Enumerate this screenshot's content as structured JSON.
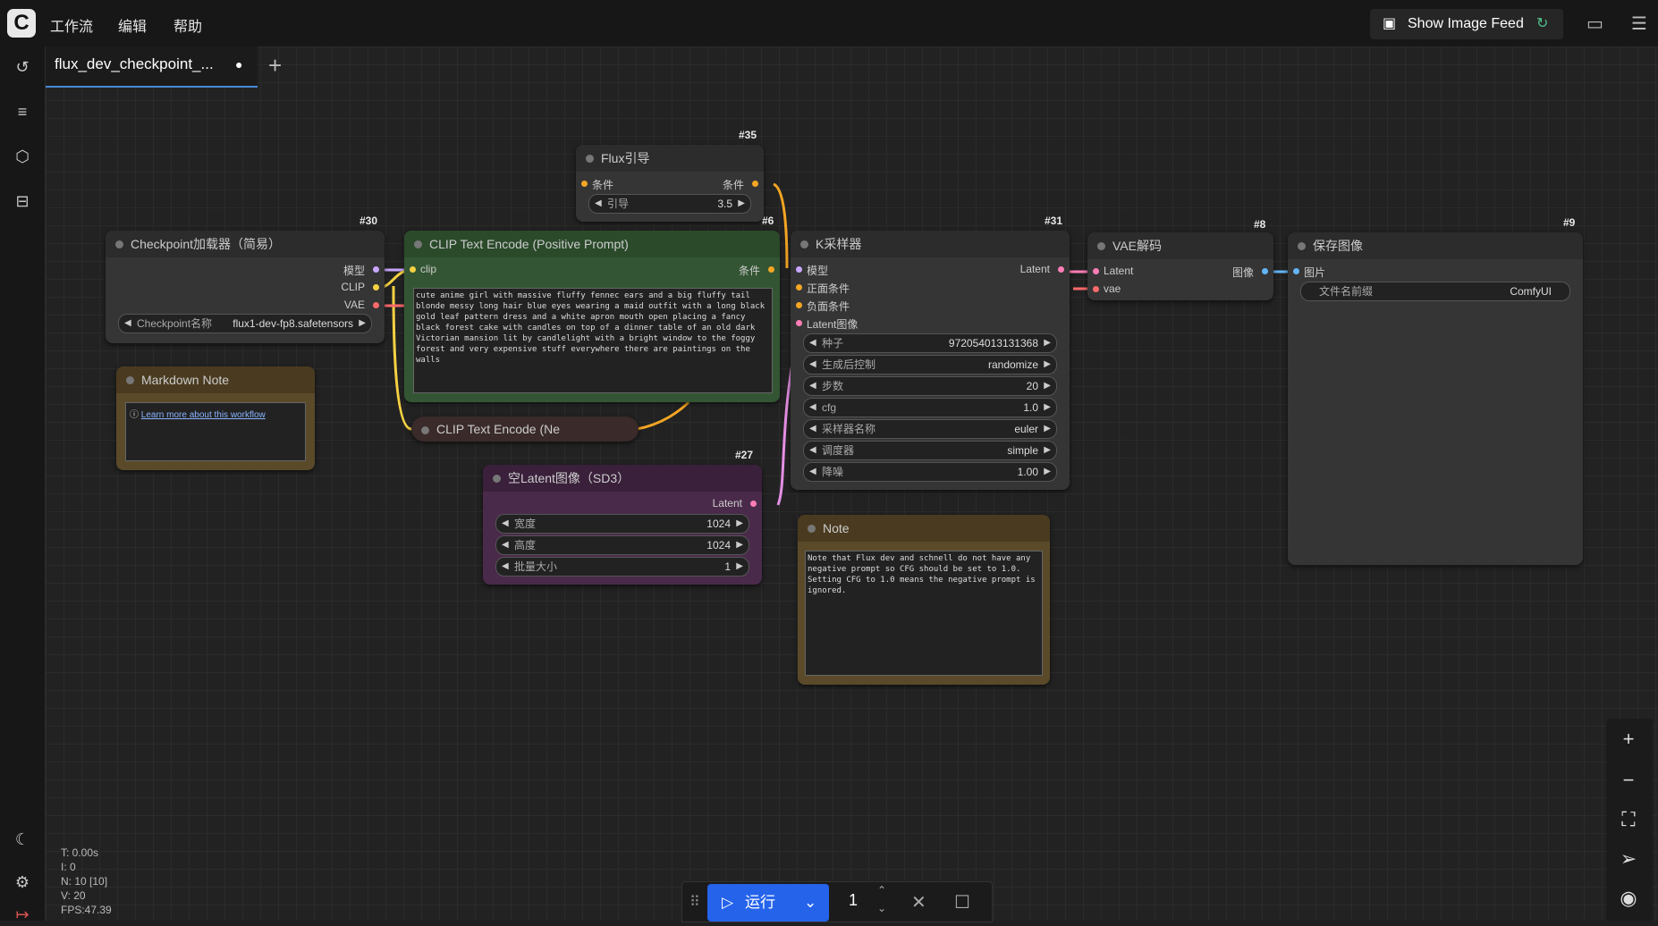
{
  "menu": {
    "workflow": "工作流",
    "edit": "编辑",
    "help": "帮助"
  },
  "feed_button": "Show Image Feed",
  "tab": {
    "title": "flux_dev_checkpoint_..."
  },
  "nodes": {
    "flux_guidance": {
      "id": "#35",
      "title": "Flux引导",
      "in": "条件",
      "out": "条件",
      "guidance_label": "引导",
      "guidance_value": "3.5"
    },
    "checkpoint": {
      "id": "#30",
      "title": "Checkpoint加载器（简易）",
      "out_model": "模型",
      "out_clip": "CLIP",
      "out_vae": "VAE",
      "ckpt_label": "Checkpoint名称",
      "ckpt_value": "flux1-dev-fp8.safetensors"
    },
    "clip_pos": {
      "id": "#6",
      "title": "CLIP Text Encode (Positive Prompt)",
      "in": "clip",
      "out": "条件",
      "text": "cute anime girl with massive fluffy fennec ears and a big fluffy tail blonde messy long hair blue eyes wearing a maid outfit with a long black gold leaf pattern dress and a white apron mouth open placing a fancy black forest cake with candles on top of a dinner table of an old dark Victorian mansion lit by candlelight with a bright window to the foggy forest and very expensive stuff everywhere there are paintings on the walls"
    },
    "clip_neg": {
      "title": "CLIP Text Encode (Ne"
    },
    "markdown": {
      "title": "Markdown Note",
      "link": "Learn more about this workflow"
    },
    "ksampler": {
      "id": "#31",
      "title": "K采样器",
      "in_model": "模型",
      "in_pos": "正面条件",
      "in_neg": "负面条件",
      "in_latent": "Latent图像",
      "out": "Latent",
      "widgets": [
        {
          "label": "种子",
          "value": "972054013131368"
        },
        {
          "label": "生成后控制",
          "value": "randomize"
        },
        {
          "label": "步数",
          "value": "20"
        },
        {
          "label": "cfg",
          "value": "1.0"
        },
        {
          "label": "采样器名称",
          "value": "euler"
        },
        {
          "label": "调度器",
          "value": "simple"
        },
        {
          "label": "降噪",
          "value": "1.00"
        }
      ]
    },
    "empty_latent": {
      "id": "#27",
      "title": "空Latent图像（SD3）",
      "out": "Latent",
      "w_label": "宽度",
      "w_value": "1024",
      "h_label": "高度",
      "h_value": "1024",
      "b_label": "批量大小",
      "b_value": "1"
    },
    "vae_decode": {
      "id": "#8",
      "title": "VAE解码",
      "in_latent": "Latent",
      "in_vae": "vae",
      "out": "图像"
    },
    "save_image": {
      "id": "#9",
      "title": "保存图像",
      "in": "图片",
      "prefix_label": "文件名前缀",
      "prefix_value": "ComfyUI"
    },
    "note": {
      "title": "Note",
      "text": "Note that Flux dev and schnell do not have any negative prompt so CFG should be set to 1.0. Setting CFG to 1.0 means the negative prompt is ignored."
    }
  },
  "stats": [
    "T: 0.00s",
    "I: 0",
    "N: 10 [10]",
    "V: 20",
    "FPS:47.39"
  ],
  "run": {
    "label": "运行",
    "count": "1"
  },
  "colors": {
    "accent": "#2563eb",
    "clip_node": "#335533",
    "latent_node": "#4a2a4a",
    "note_node": "#5a4a2a",
    "neg_node": "#3a2a2a"
  }
}
